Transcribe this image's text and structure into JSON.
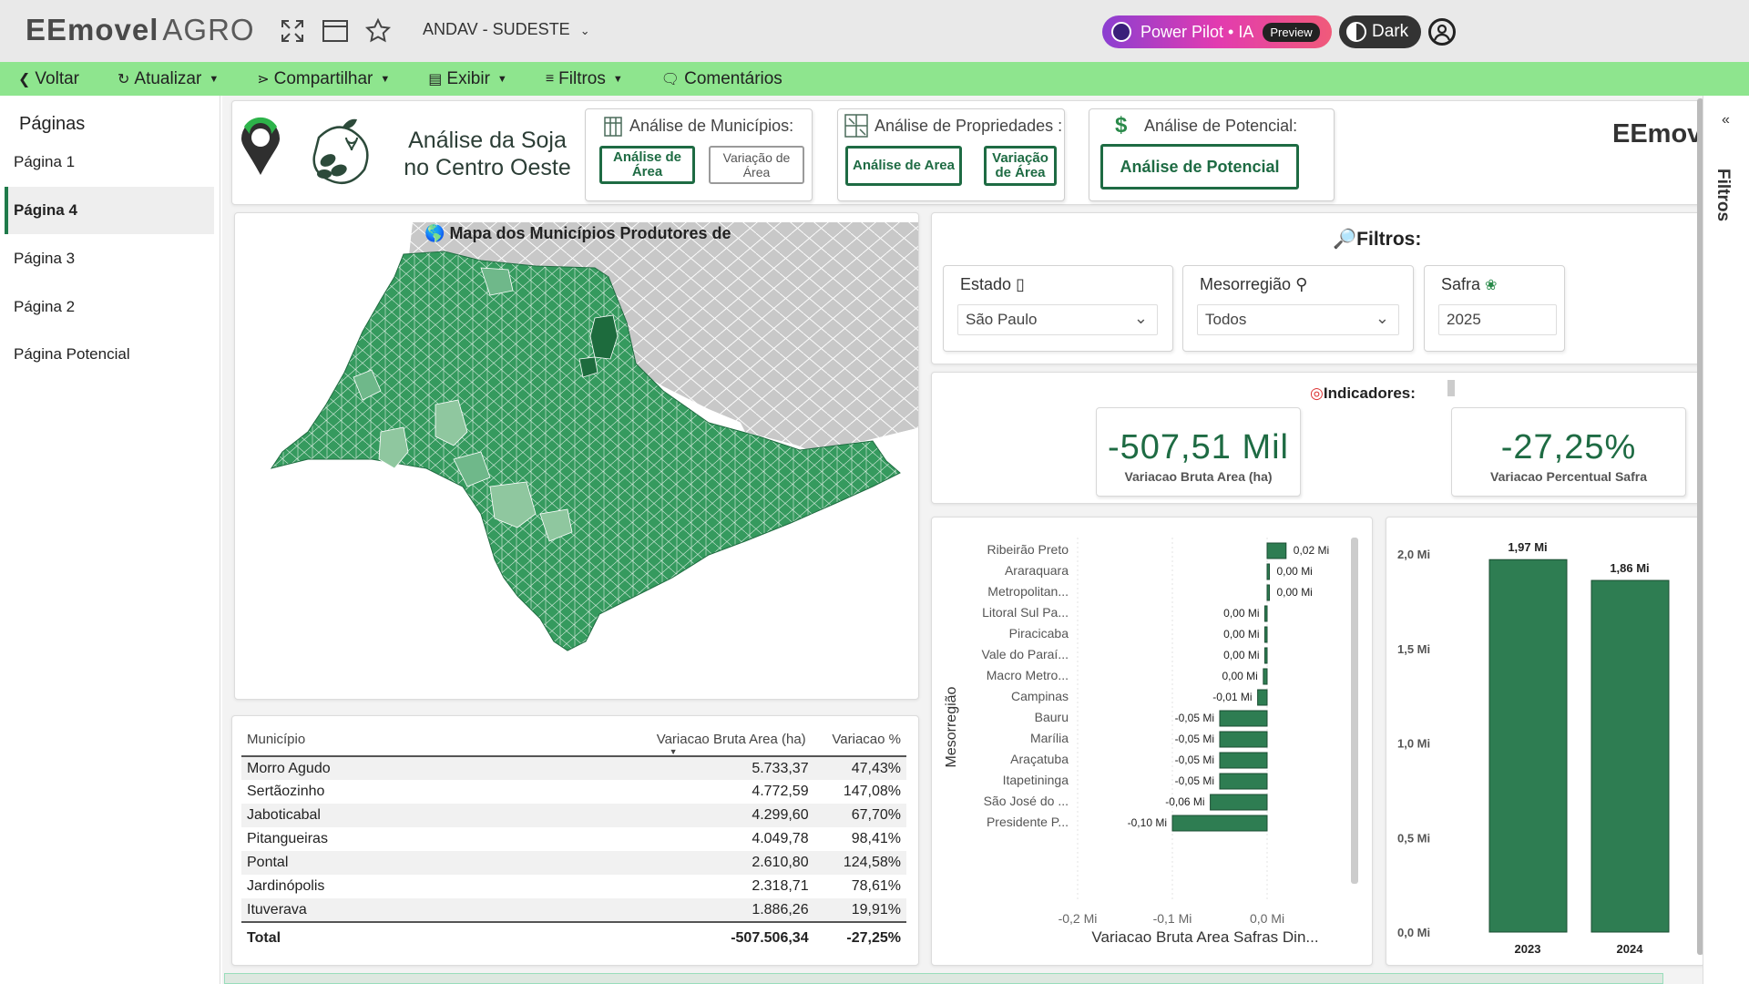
{
  "app": {
    "logo_text": "EEmovel",
    "logo_suffix": "AGRO",
    "workspace": "ANDAV - SUDESTE",
    "power_pilot": "Power Pilot • IA",
    "power_pilot_badge": "Preview",
    "dark_label": "Dark"
  },
  "toolbar": {
    "back": "Voltar",
    "refresh": "Atualizar",
    "share": "Compartilhar",
    "view": "Exibir",
    "filters": "Filtros",
    "comments": "Comentários"
  },
  "pages": {
    "title": "Páginas",
    "items": [
      "Página 1",
      "Página 4",
      "Página 3",
      "Página 2",
      "Página Potencial"
    ],
    "active": "Página 4"
  },
  "header": {
    "title": "Análise da Soja no Centro Oeste",
    "municipios": {
      "title": "Análise de Municípios:",
      "btn1": "Análise de Área",
      "btn2": "Variação de Área"
    },
    "propriedades": {
      "title": "Análise de Propriedades :",
      "btn1": "Análise de Area",
      "btn2": "Variação de Área"
    },
    "potencial": {
      "title": "Análise de Potencial:",
      "btn1": "Análise de Potencial"
    },
    "brand_right": "EEmovel"
  },
  "map": {
    "title": "Mapa dos Municípios Produtores de",
    "colors": {
      "high": "#2e8b57",
      "mid": "#4ea36c",
      "light": "#8fc79f",
      "dark": "#1d6b3d",
      "outside": "#c8c8c8"
    }
  },
  "table": {
    "headers": [
      "Município",
      "Variacao Bruta Area (ha)",
      "Variacao %"
    ],
    "rows": [
      [
        "Morro Agudo",
        "5.733,37",
        "47,43%"
      ],
      [
        "Sertãozinho",
        "4.772,59",
        "147,08%"
      ],
      [
        "Jaboticabal",
        "4.299,60",
        "67,70%"
      ],
      [
        "Pitangueiras",
        "4.049,78",
        "98,41%"
      ],
      [
        "Pontal",
        "2.610,80",
        "124,58%"
      ],
      [
        "Jardinópolis",
        "2.318,71",
        "78,61%"
      ],
      [
        "Ituverava",
        "1.886,26",
        "19,91%"
      ]
    ],
    "total": [
      "Total",
      "-507.506,34",
      "-27,25%"
    ]
  },
  "filters": {
    "title": "Filtros:",
    "estado": {
      "label": "Estado",
      "value": "São Paulo"
    },
    "mesorregiao": {
      "label": "Mesorregião",
      "value": "Todos"
    },
    "safra": {
      "label": "Safra",
      "value": "2025"
    }
  },
  "indicators": {
    "title": "Indicadores:",
    "kpi1": {
      "value": "-507,51 Mil",
      "label": "Variacao Bruta Area (ha)"
    },
    "kpi2": {
      "value": "-27,25%",
      "label": "Variacao Percentual Safra"
    }
  },
  "chart_data": [
    {
      "type": "bar",
      "orientation": "horizontal",
      "categories": [
        "Ribeirão Preto",
        "Araraquara",
        "Metropolitan...",
        "Litoral Sul Pa...",
        "Piracicaba",
        "Vale do Paraí...",
        "Macro Metro...",
        "Campinas",
        "Bauru",
        "Marília",
        "Araçatuba",
        "Itapetininga",
        "São José do ...",
        "Presidente P..."
      ],
      "values": [
        0.02,
        0.0,
        0.0,
        -0.001,
        -0.001,
        -0.002,
        -0.004,
        -0.01,
        -0.05,
        -0.05,
        -0.05,
        -0.05,
        -0.06,
        -0.1
      ],
      "data_labels": [
        "0,02 Mi",
        "0,00 Mi",
        "0,00 Mi",
        "0,00 Mi",
        "0,00 Mi",
        "0,00 Mi",
        "0,00 Mi",
        "-0,01 Mi",
        "-0,05 Mi",
        "-0,05 Mi",
        "-0,05 Mi",
        "-0,05 Mi",
        "-0,06 Mi",
        "-0,10 Mi"
      ],
      "xlabel": "Variacao Bruta Area Safras Din...",
      "ylabel": "Mesorregião",
      "xlim": [
        -0.2,
        0.0
      ],
      "xticks": [
        "-0,2 Mi",
        "-0,1 Mi",
        "0,0 Mi"
      ],
      "color": "#2e7d52"
    },
    {
      "type": "bar",
      "categories": [
        "2023",
        "2024"
      ],
      "values": [
        1.97,
        1.86
      ],
      "data_labels": [
        "1,97 Mi",
        "1,86 Mi"
      ],
      "ylim": [
        0,
        2.0
      ],
      "yticks": [
        "0,0 Mi",
        "0,5 Mi",
        "1,0 Mi",
        "1,5 Mi",
        "2,0 Mi"
      ],
      "color": "#2e7d52"
    }
  ]
}
